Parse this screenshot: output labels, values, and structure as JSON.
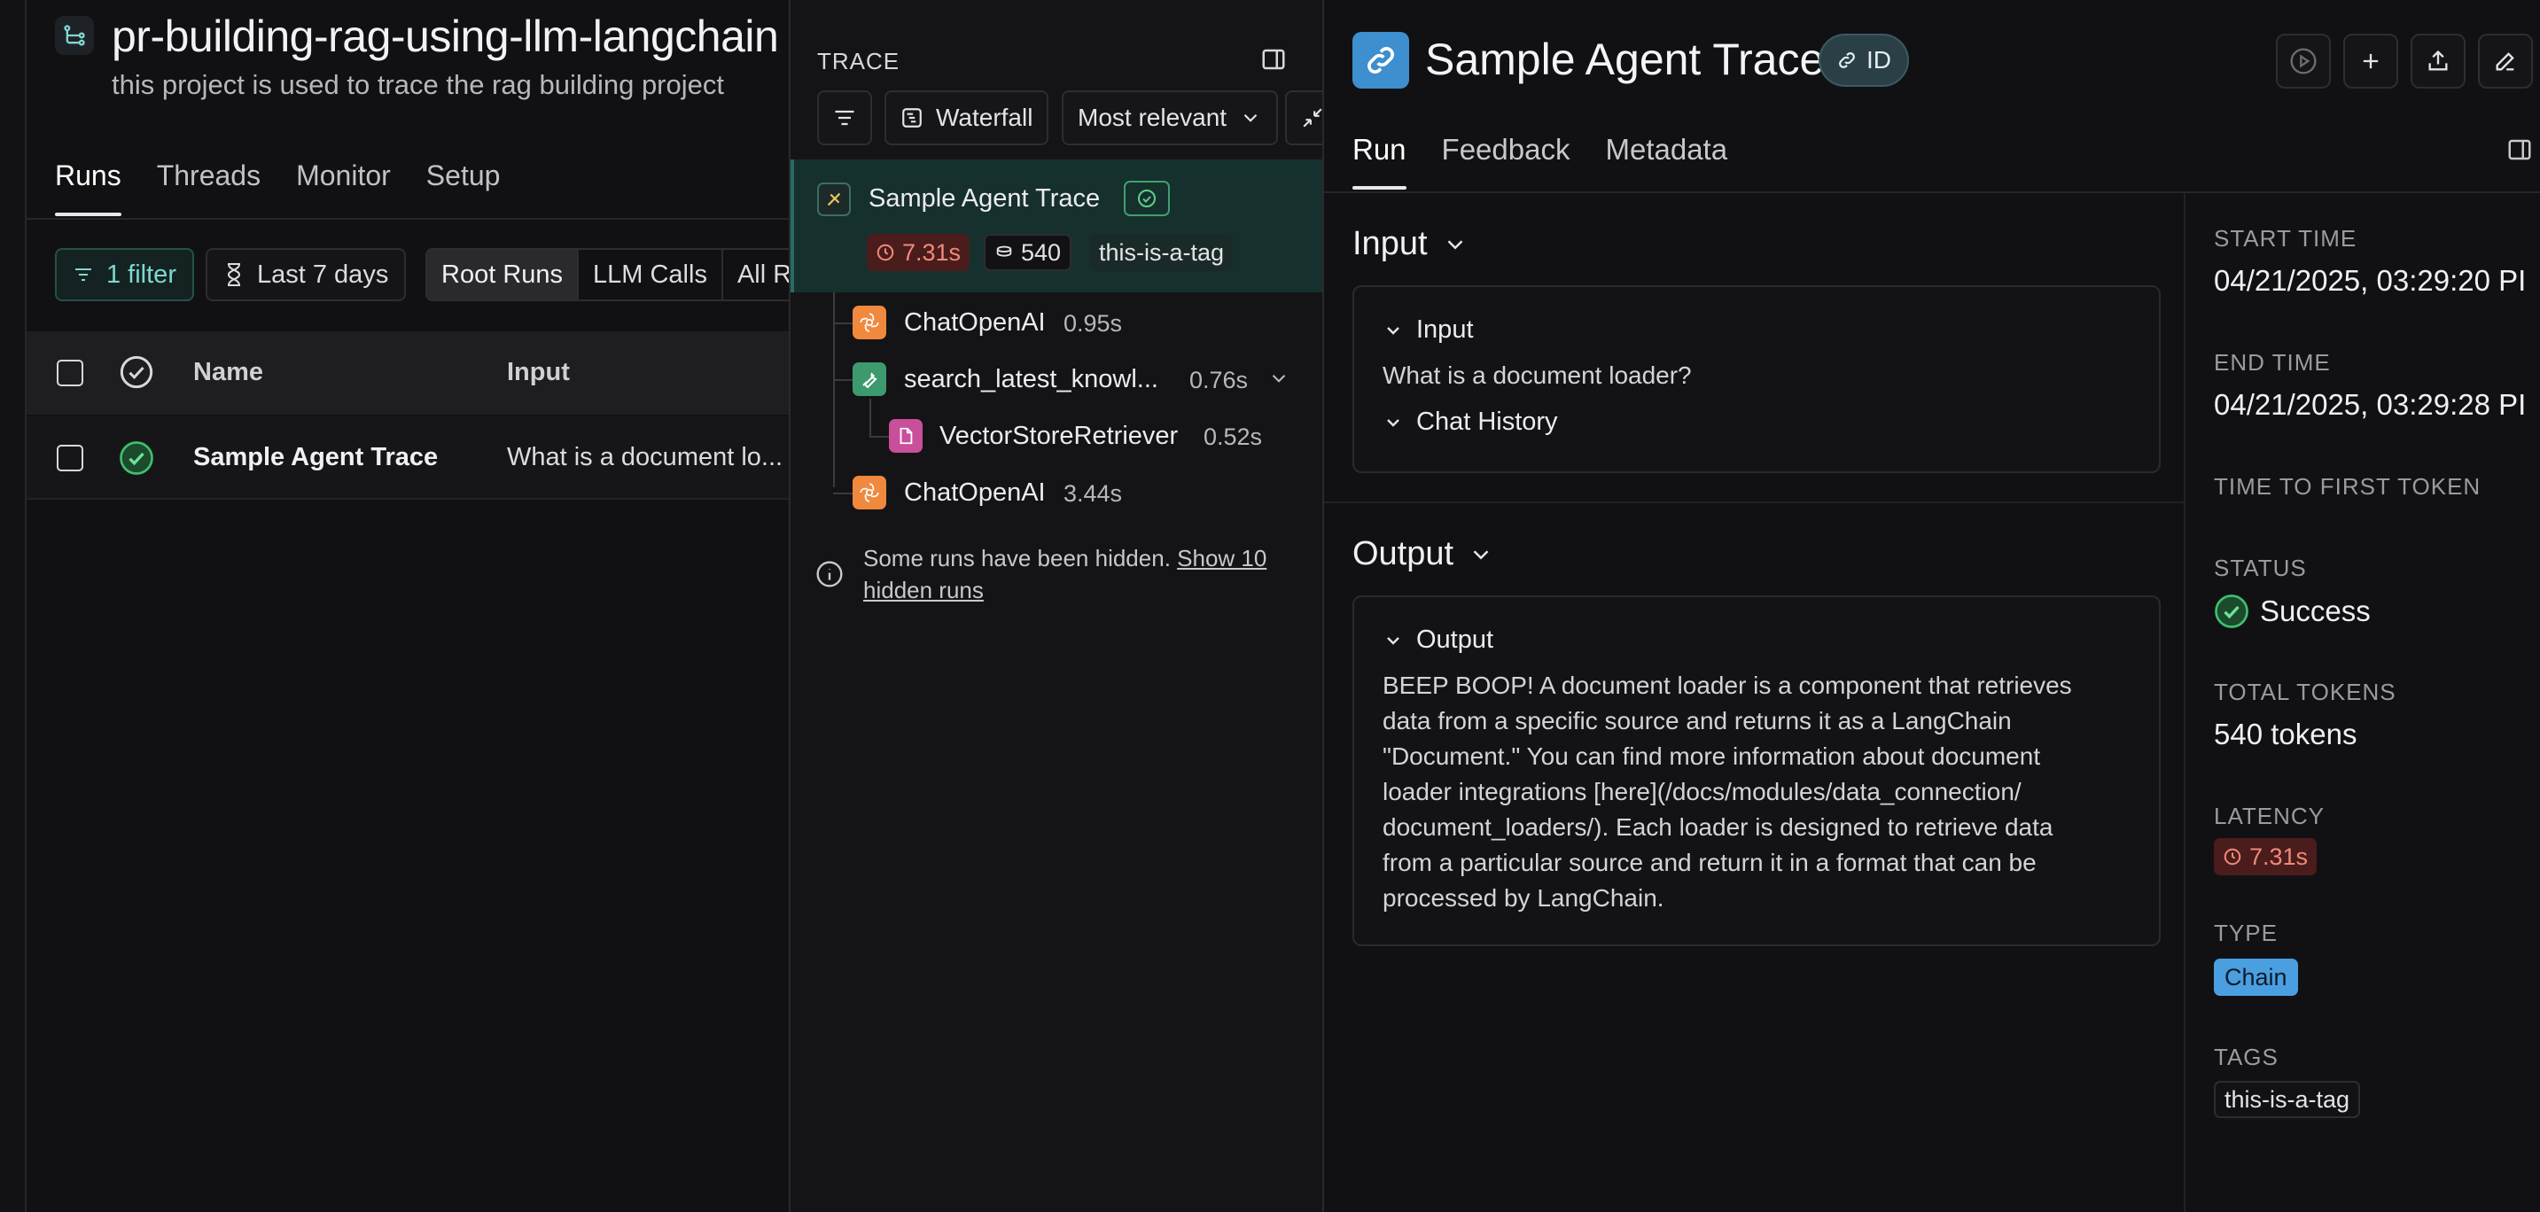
{
  "project": {
    "title": "pr-building-rag-using-llm-langchain",
    "description": "this project is used to trace the rag building project",
    "tabs": [
      "Runs",
      "Threads",
      "Monitor",
      "Setup"
    ],
    "filters": {
      "filter_label": "1 filter",
      "date_range": "Last 7 days",
      "run_types": [
        "Root Runs",
        "LLM Calls",
        "All R"
      ]
    },
    "table": {
      "headers": {
        "name": "Name",
        "input": "Input"
      },
      "rows": [
        {
          "name": "Sample Agent Trace",
          "input": "What is a document lo..."
        }
      ]
    }
  },
  "trace": {
    "header": "TRACE",
    "view_label": "Waterfall",
    "sort_label": "Most relevant",
    "root": {
      "name": "Sample Agent Trace",
      "latency": "7.31s",
      "tokens": "540",
      "tag": "this-is-a-tag"
    },
    "nodes": [
      {
        "name": "ChatOpenAI",
        "duration": "0.95s"
      },
      {
        "name": "search_latest_knowl...",
        "duration": "0.76s"
      },
      {
        "name": "VectorStoreRetriever",
        "duration": "0.52s"
      },
      {
        "name": "ChatOpenAI",
        "duration": "3.44s"
      }
    ],
    "hidden_note": "Some runs have been hidden.",
    "hidden_link": "Show 10 hidden runs"
  },
  "detail": {
    "title": "Sample Agent Trace",
    "id_label": "ID",
    "tabs": [
      "Run",
      "Feedback",
      "Metadata"
    ],
    "input": {
      "section_title": "Input",
      "card_title": "Input",
      "text": "What is a document loader?",
      "chat_history": "Chat History"
    },
    "output": {
      "section_title": "Output",
      "card_title": "Output",
      "lines": [
        "BEEP BOOP! A document loader is a component that retrieves",
        "data from a specific source and returns it as a LangChain",
        "\"Document.\" You can find more information about document",
        "loader integrations [here](/docs/modules/data_connection/",
        "document_loaders/). Each loader is designed to retrieve data",
        "from a particular source and return it in a format that can be",
        "processed by LangChain."
      ]
    },
    "meta": {
      "start_time_label": "START TIME",
      "start_time": "04/21/2025, 03:29:20 PI",
      "end_time_label": "END TIME",
      "end_time": "04/21/2025, 03:29:28 PI",
      "ttft_label": "TIME TO FIRST TOKEN",
      "status_label": "STATUS",
      "status": "Success",
      "total_tokens_label": "TOTAL TOKENS",
      "total_tokens": "540 tokens",
      "latency_label": "LATENCY",
      "latency": "7.31s",
      "type_label": "TYPE",
      "type": "Chain",
      "tags_label": "TAGS",
      "tag": "this-is-a-tag"
    }
  },
  "colors": {
    "accent_teal": "#2a6b64",
    "success": "#3fbf6f",
    "latency_bg": "#4a1c1c",
    "latency_fg": "#f08a7a",
    "chain_badge": "#4a9fe0",
    "openai_orange": "#f0883e",
    "tool_green": "#3d9a6e",
    "retriever_pink": "#c94f9a"
  },
  "icons": [
    "project-icon",
    "filter-icon",
    "hourglass-icon",
    "check-circle-icon",
    "list-filter-icon",
    "waterfall-icon",
    "chevron-down-icon",
    "collapse-icon",
    "panel-icon",
    "chain-icon",
    "clock-icon",
    "tokens-icon",
    "openai-icon",
    "wrench-icon",
    "document-icon",
    "info-icon",
    "link-icon",
    "play-icon",
    "plus-icon",
    "share-icon",
    "edit-icon"
  ]
}
